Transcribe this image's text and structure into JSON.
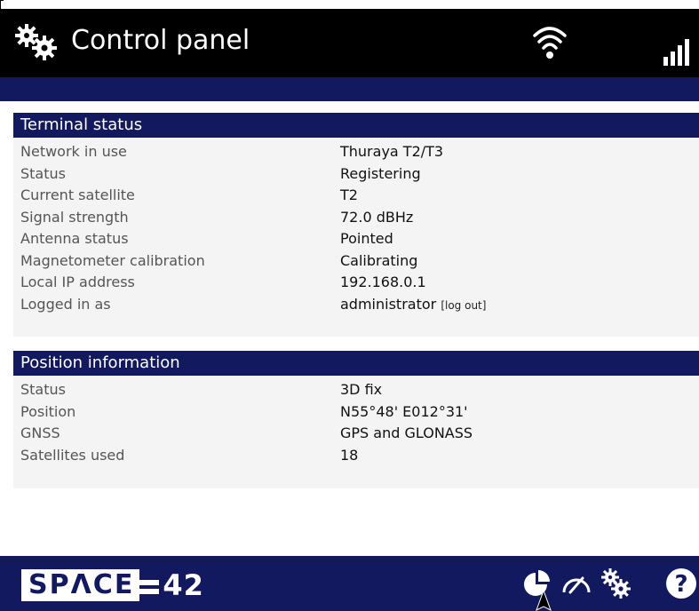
{
  "header": {
    "title": "Control panel",
    "icons": [
      "gears-icon",
      "wifi-icon",
      "signal-icon"
    ]
  },
  "terminal_status": {
    "title": "Terminal status",
    "rows": [
      {
        "label": "Network in use",
        "value": "Thuraya T2/T3"
      },
      {
        "label": "Status",
        "value": "Registering"
      },
      {
        "label": "Current satellite",
        "value": "T2"
      },
      {
        "label": "Signal strength",
        "value": "72.0 dBHz"
      },
      {
        "label": "Antenna status",
        "value": "Pointed"
      },
      {
        "label": "Magnetometer calibration",
        "value": "Calibrating"
      },
      {
        "label": "Local IP address",
        "value": "192.168.0.1"
      },
      {
        "label": "Logged in as",
        "value": "administrator",
        "link": "[log out]"
      }
    ]
  },
  "position_information": {
    "title": "Position information",
    "rows": [
      {
        "label": "Status",
        "value": "3D fix"
      },
      {
        "label": "Position",
        "value": "N55°48' E012°31'"
      },
      {
        "label": "GNSS",
        "value": "GPS and GLONASS"
      },
      {
        "label": "Satellites used",
        "value": "18"
      }
    ]
  },
  "footer": {
    "logo_text": "SPΛCE",
    "logo_number": "42",
    "icons": [
      "pie-chart-icon",
      "speedometer-icon",
      "settings-gears-icon",
      "help-icon"
    ]
  },
  "colors": {
    "header_bg": "#000000",
    "brand_navy": "#13195f",
    "panel_bg": "#f4f4f4"
  }
}
